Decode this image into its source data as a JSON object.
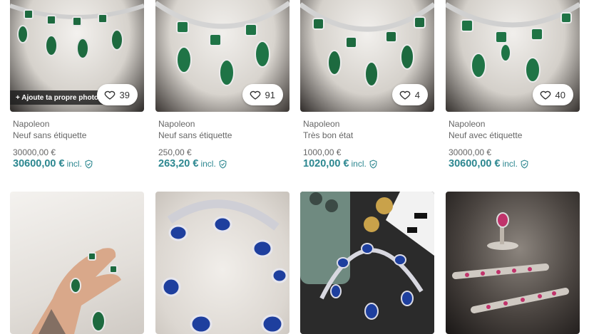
{
  "items": [
    {
      "brand": "Napoleon",
      "condition": "Neuf sans étiquette",
      "price": "30000,00 €",
      "total": "30600,00 €",
      "incl": "incl.",
      "likes": "39",
      "promo": "+ Ajoute ta propre photo"
    },
    {
      "brand": "Napoleon",
      "condition": "Neuf sans étiquette",
      "price": "250,00 €",
      "total": "263,20 €",
      "incl": "incl.",
      "likes": "91"
    },
    {
      "brand": "Napoleon",
      "condition": "Très bon état",
      "price": "1000,00 €",
      "total": "1020,00 €",
      "incl": "incl.",
      "likes": "4"
    },
    {
      "brand": "Napoleon",
      "condition": "Neuf avec étiquette",
      "price": "30000,00 €",
      "total": "30600,00 €",
      "incl": "incl.",
      "likes": "40"
    }
  ],
  "photos_row2": [
    "hand-emerald-necklace",
    "sapphire-necklace",
    "sapphire-necklace-with-phone",
    "ruby-bracelets-museum"
  ],
  "colors": {
    "accent": "#2c8790",
    "muted": "#666666",
    "emerald": "#1d6a3f",
    "sapphire": "#1e3f9e",
    "ruby": "#c0336b"
  }
}
